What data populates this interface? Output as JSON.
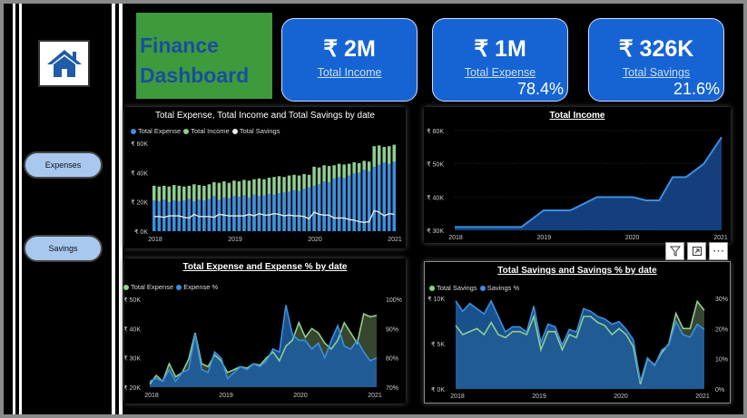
{
  "sidebar": {
    "home_icon": "home-icon",
    "buttons": [
      {
        "label": "Expenses"
      },
      {
        "label": "Savings"
      }
    ]
  },
  "title": "Finance Dashboard",
  "kpis": [
    {
      "value": "₹ 2M",
      "label": "Total Income",
      "pct": ""
    },
    {
      "value": "₹ 1M",
      "label": "Total Expense",
      "pct": "78.4%"
    },
    {
      "value": "₹ 326K",
      "label": "Total Savings",
      "pct": "21.6%"
    }
  ],
  "colors": {
    "expense": "#3b8fe0",
    "income": "#8fcf8f",
    "savings": "#e8e8e8",
    "area": "#1d5fa6",
    "kpi": "#1664d4",
    "title_bg": "#3d9a3d"
  },
  "toolbar": {
    "icons": [
      "filter-icon",
      "focus-mode-icon",
      "more-options-icon"
    ]
  },
  "chart_data": [
    {
      "type": "bar",
      "title": "Total Expense, Total Income and Total Savings by date",
      "legend": [
        "Total Expense",
        "Total Income",
        "Total Savings"
      ],
      "legend_position": "top-left",
      "x_ticks": [
        "2018",
        "2019",
        "2020",
        "2021"
      ],
      "y_ticks": [
        "₹ 0K",
        "₹ 20K",
        "₹ 40K",
        "₹ 60K"
      ],
      "ylim": [
        0,
        60000
      ],
      "series": [
        {
          "name": "Total Expense",
          "values": [
            21000,
            20500,
            21500,
            20000,
            21000,
            20500,
            21000,
            22000,
            20500,
            21500,
            21000,
            22000,
            24000,
            21500,
            23000,
            22500,
            24000,
            23500,
            24500,
            23000,
            25000,
            24000,
            24500,
            25500,
            25000,
            26000,
            26500,
            27000,
            28000,
            27500,
            29000,
            30000,
            31000,
            32000,
            34000,
            33500,
            36000,
            37000,
            36500,
            38000,
            39500,
            40000,
            42000,
            41000,
            44000,
            45500,
            47000,
            46000,
            47500
          ]
        },
        {
          "name": "Total Income",
          "values": [
            31000,
            30500,
            31000,
            30500,
            31500,
            31000,
            30500,
            31000,
            32000,
            31500,
            31000,
            32000,
            33500,
            33000,
            34000,
            33000,
            34500,
            34000,
            35000,
            34500,
            35500,
            36000,
            35500,
            36500,
            37000,
            37500,
            37000,
            38000,
            38500,
            38000,
            39000,
            38500,
            44000,
            43500,
            45000,
            44500,
            45000,
            46000,
            45500,
            46000,
            47000,
            46500,
            48000,
            47500,
            58000,
            58500,
            57500,
            58000,
            59000
          ]
        },
        {
          "name": "Total Savings",
          "values": [
            10000,
            10000,
            9500,
            10500,
            10500,
            10500,
            9500,
            9000,
            11500,
            10000,
            10000,
            10000,
            9500,
            11500,
            11000,
            10500,
            10500,
            10500,
            10500,
            11500,
            10500,
            12000,
            11000,
            11000,
            12000,
            11500,
            10500,
            11000,
            10500,
            10500,
            10000,
            8500,
            13000,
            11500,
            11000,
            11000,
            9000,
            9000,
            9000,
            8000,
            7500,
            6500,
            6000,
            6500,
            14000,
            13000,
            10500,
            12000,
            11500
          ]
        }
      ]
    },
    {
      "type": "area",
      "title": "Total Income",
      "x_ticks": [
        "2018",
        "2019",
        "2020",
        "2021"
      ],
      "y_ticks": [
        "₹ 30K",
        "₹ 40K",
        "₹ 50K",
        "₹ 60K"
      ],
      "ylim": [
        30000,
        60000
      ],
      "x": [
        2018.0,
        2018.35,
        2018.6,
        2018.75,
        2019.0,
        2019.1,
        2019.3,
        2019.6,
        2019.8,
        2020.0,
        2020.15,
        2020.3,
        2020.45,
        2020.6,
        2020.8,
        2021.0
      ],
      "values": [
        31000,
        31000,
        31000,
        31000,
        36000,
        36000,
        36000,
        40000,
        40000,
        40000,
        39000,
        39000,
        46000,
        46000,
        50000,
        58000
      ]
    },
    {
      "type": "area",
      "title": "Total Expense and Expense % by date",
      "legend": [
        "Total Expense",
        "Expense %"
      ],
      "legend_position": "top-left",
      "x_ticks": [
        "2018",
        "2019",
        "2020",
        "2021"
      ],
      "y_ticks": [
        "₹ 20K",
        "₹ 30K",
        "₹ 40K",
        "₹ 50K"
      ],
      "y2_ticks": [
        "70%",
        "80%",
        "90%",
        "100%"
      ],
      "ylim": [
        20000,
        50000
      ],
      "y2lim": [
        70,
        100
      ],
      "series": [
        {
          "name": "Total Expense",
          "values": [
            21000,
            24000,
            22000,
            28000,
            23500,
            25000,
            29500,
            38500,
            28000,
            27000,
            31000,
            29000,
            25000,
            26000,
            27000,
            26500,
            28000,
            27500,
            30000,
            32000,
            29000,
            34000,
            36000,
            42000,
            37000,
            40000,
            38500,
            35000,
            33000,
            36000,
            42000,
            38500,
            35000,
            45000,
            44000,
            44500
          ]
        },
        {
          "name": "Expense %",
          "values": [
            72,
            73,
            72,
            76,
            72,
            75,
            76,
            88,
            76,
            75,
            82,
            80,
            73,
            75,
            77,
            76,
            78,
            77,
            79,
            83,
            82,
            98,
            88,
            86,
            86,
            83,
            85,
            80,
            86,
            91,
            84,
            83,
            86,
            82,
            79,
            80
          ]
        }
      ]
    },
    {
      "type": "area",
      "title": "Total Savings and Savings % by date",
      "legend": [
        "Total Savings",
        "Savings %"
      ],
      "legend_position": "top-left",
      "x_ticks": [
        "2018",
        "2019",
        "2020",
        "2021"
      ],
      "y_ticks": [
        "₹ 0K",
        "₹ 5K",
        "₹ 10K"
      ],
      "y2_ticks": [
        "0%",
        "10%",
        "20%",
        "30%"
      ],
      "ylim": [
        0,
        15000
      ],
      "y2lim": [
        0,
        35
      ],
      "series": [
        {
          "name": "Total Savings",
          "values": [
            10500,
            9000,
            9500,
            10000,
            9000,
            11000,
            9000,
            8500,
            9500,
            9500,
            9000,
            12000,
            6500,
            9500,
            9500,
            6500,
            9000,
            8500,
            12000,
            12000,
            11000,
            10500,
            9000,
            10000,
            9000,
            7000,
            800,
            5000,
            4000,
            6000,
            7500,
            12500,
            10000,
            10000,
            14500,
            13000
          ]
        },
        {
          "name": "Savings %",
          "values": [
            34,
            30,
            33,
            31,
            29,
            34,
            28,
            22,
            24,
            24,
            22,
            32,
            18,
            25,
            24,
            17,
            23,
            22,
            31,
            30,
            28,
            27,
            25,
            26,
            23,
            19,
            3,
            12,
            9,
            15,
            17,
            26,
            21,
            20,
            25,
            23
          ]
        }
      ]
    }
  ]
}
